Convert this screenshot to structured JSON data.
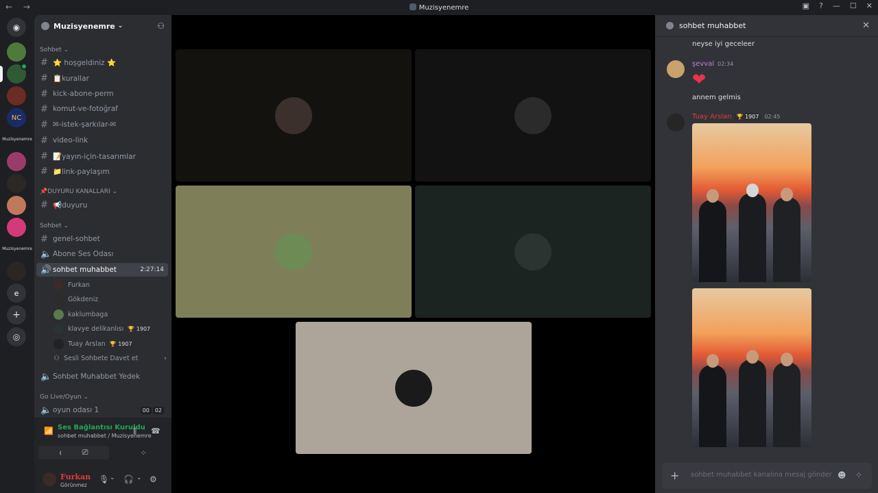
{
  "window": {
    "title": "Muzisyenemre"
  },
  "rail": {
    "text_servers": [
      "Muzisyenemre",
      "Muzisyenemre",
      "e"
    ]
  },
  "guild": {
    "name": "Muzisyenemre"
  },
  "categories": {
    "sohbet1": "Sohbet",
    "duyuru": "📌DUYURU KANALLARI",
    "sohbet2": "Sohbet",
    "golive": "Go Live/Oyun"
  },
  "channels": [
    "⭐ hoşgeldiniz ⭐",
    "📋kurallar",
    "kick-abone-perm",
    "komut-ve-fotoğraf",
    "✉-istek-şarkılar-✉",
    "video-link",
    "📝yayın-için-tasarımlar",
    "📁link-paylaşım",
    "📢duyuru",
    "genel-sohbet"
  ],
  "voice_channels": {
    "abone": "Abone Ses Odası",
    "sohbet": "sohbet muhabbet",
    "sohbet_time": "2:27:14",
    "yedek": "Sohbet Muhabbet Yedek",
    "oyun": "oyun odası 1",
    "oyun_cnt_a": "00",
    "oyun_cnt_b": "02"
  },
  "voice_users": [
    {
      "name": "Furkan",
      "color": "#3a2a28"
    },
    {
      "name": "Gökdeniz",
      "color": "#2c2c2c"
    },
    {
      "name": "kaklumbaga",
      "color": "#5c7a4a"
    },
    {
      "name": "klavye delikanlısı",
      "color": "#2a3330",
      "trophy": "🏆 1907"
    },
    {
      "name": "Tuay Arslan",
      "color": "#222",
      "trophy": "🏆 1907"
    }
  ],
  "voice_invite": "Sesli Sohbete Davet et",
  "voice_panel": {
    "status": "Ses Bağlantısı Kuruldu",
    "sub": "sohbet muhabbet / Muzisyenemre"
  },
  "user": {
    "name": "Furkan",
    "status": "Görünmez"
  },
  "stage": {
    "tiles": [
      {
        "bg": "#13120f",
        "face": "#3b302c"
      },
      {
        "bg": "#121212",
        "face": "#2b2b2b"
      },
      {
        "bg": "#7e7f58",
        "face": "#6d8b55"
      },
      {
        "bg": "#1b2420",
        "face": "#2c3432"
      },
      {
        "bg": "#ada59a",
        "face": "#1a1a1a"
      }
    ]
  },
  "chat": {
    "channel": "sohbet muhabbet",
    "messages": {
      "m1": "neyse iyi geceleer",
      "u2": "şevval",
      "t2": "02:34",
      "m2": "annem gelmis",
      "u3": "Tuay Arslan",
      "trophy3": "🏆 1907",
      "t3": "02:45"
    },
    "placeholder": "sohbet muhabbet kanalına mesaj gönder"
  },
  "colors": {
    "accent": "#23a55a",
    "username_red": "#e53a3a",
    "username_purple": "#c77bdc"
  }
}
